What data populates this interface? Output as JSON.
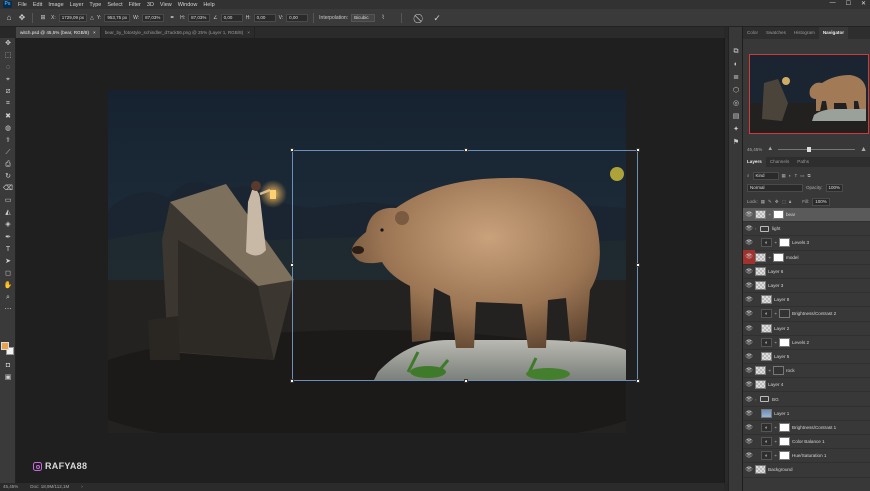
{
  "app": {
    "logo": "Ps"
  },
  "menu": [
    "File",
    "Edit",
    "Image",
    "Layer",
    "Type",
    "Select",
    "Filter",
    "3D",
    "View",
    "Window",
    "Help"
  ],
  "window_controls": [
    "—",
    "☐",
    "✕"
  ],
  "options_bar": {
    "x_label": "X:",
    "x_value": "1729,09 px",
    "y_label": "Y:",
    "y_value": "953,75 px",
    "w_label": "W:",
    "w_value": "87,03%",
    "h_label": "H:",
    "h_value": "87,03%",
    "angle_value": "0,00",
    "hskew_label": "H:",
    "hskew_value": "0,00",
    "vskew_label": "V:",
    "vskew_value": "0,00",
    "interp_label": "Interpolation:",
    "interp_value": "Bicubic",
    "cancel_icon": "⃠",
    "commit_icon": "✓"
  },
  "tabs": [
    {
      "title": "witch.psd @ 45,5% (bear, RGB/8)",
      "close": "×",
      "active": true
    },
    {
      "title": "bear_by_fotostyle_schindler_d7ack56.png @ 25% (Layer 1, RGB/8)",
      "close": "×",
      "active": false
    }
  ],
  "tools": [
    "✥",
    "⬚",
    "◌",
    "⌖",
    "⧄",
    "⌗",
    "✖",
    "◍",
    "⚕",
    "⟋",
    "⎙",
    "↻",
    "⌫",
    "▭",
    "◭",
    "◈",
    "✒",
    "T",
    "➤",
    "◻",
    "✋",
    "⌕",
    "⋯"
  ],
  "watermark": {
    "handle": "RAFYA88"
  },
  "status": {
    "zoom": "45,45%",
    "doc": "Doc: 18,9M/112,1M",
    "arrow": "›"
  },
  "dock_icons": [
    "⧉",
    "◐",
    "≣",
    "⬡",
    "◎",
    "▤",
    "✦",
    "⚑"
  ],
  "navigator": {
    "tabs": [
      "Color",
      "Swatches",
      "Histogram",
      "Navigator"
    ],
    "active_tab": "Navigator",
    "zoom": "45,45%",
    "zoom_position": 0.38
  },
  "layers_panel": {
    "tabs": [
      "Layers",
      "Channels",
      "Paths"
    ],
    "filter_label": "Kind",
    "blend_mode": "Normal",
    "opacity_label": "Opacity:",
    "opacity_value": "100%",
    "lock_label": "Lock:",
    "fill_label": "Fill:",
    "fill_value": "100%",
    "layers": [
      {
        "name": "bear",
        "thumb": "pixel",
        "mask": true,
        "selected": true,
        "indent": 0
      },
      {
        "name": "light",
        "thumb": "folder",
        "indent": 0
      },
      {
        "name": "Levels 3",
        "thumb": "adj",
        "mask": true,
        "indent": 1
      },
      {
        "name": "model",
        "thumb": "pixel",
        "mask": true,
        "eye_red": true,
        "indent": 0
      },
      {
        "name": "Layer 6",
        "thumb": "pixel",
        "indent": 0
      },
      {
        "name": "Layer 3",
        "thumb": "pixel",
        "indent": 0
      },
      {
        "name": "Layer 8",
        "thumb": "pixel",
        "indent": 1
      },
      {
        "name": "Brightness/Contrast 2",
        "thumb": "adj",
        "mask": "dark",
        "indent": 1
      },
      {
        "name": "Layer 2",
        "thumb": "pixel",
        "indent": 1
      },
      {
        "name": "Levels 2",
        "thumb": "adj",
        "mask": true,
        "indent": 1
      },
      {
        "name": "Layer 5",
        "thumb": "pixel",
        "indent": 1
      },
      {
        "name": "rock",
        "thumb": "pixel",
        "mask": "dark",
        "indent": 0
      },
      {
        "name": "Layer 4",
        "thumb": "pixel",
        "indent": 0
      },
      {
        "name": "BG",
        "thumb": "folder",
        "indent": 0
      },
      {
        "name": "Layer 1",
        "thumb": "sky",
        "indent": 1
      },
      {
        "name": "Brightness/Contrast 1",
        "thumb": "adj",
        "mask": true,
        "indent": 1
      },
      {
        "name": "Color Balance 1",
        "thumb": "adj",
        "mask": true,
        "indent": 1
      },
      {
        "name": "Hue/Saturation 1",
        "thumb": "adj",
        "mask": true,
        "indent": 1
      },
      {
        "name": "Background",
        "thumb": "pixel",
        "indent": 0
      }
    ]
  }
}
